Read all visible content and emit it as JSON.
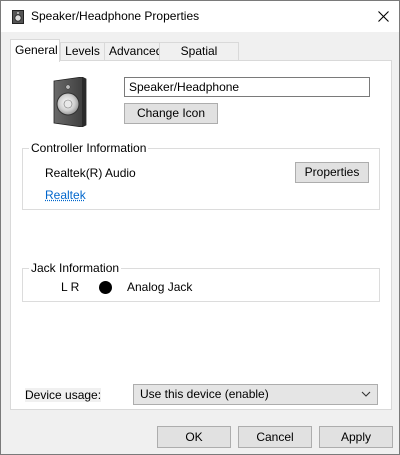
{
  "window": {
    "title": "Speaker/Headphone Properties",
    "close_glyph": "✕"
  },
  "tabs": [
    {
      "label": "General",
      "active": true
    },
    {
      "label": "Levels",
      "active": false
    },
    {
      "label": "Advanced",
      "active": false
    },
    {
      "label": "Spatial sound",
      "active": false
    }
  ],
  "general": {
    "device_name": "Speaker/Headphone",
    "change_icon_label": "Change Icon",
    "controller": {
      "legend": "Controller Information",
      "name": "Realtek(R) Audio",
      "properties_label": "Properties",
      "vendor_link": "Realtek"
    },
    "jack": {
      "legend": "Jack Information",
      "channels": "L R",
      "type": "Analog Jack"
    },
    "device_usage": {
      "label": "Device usage:",
      "selected": "Use this device (enable)"
    }
  },
  "footer": {
    "ok_label": "OK",
    "cancel_label": "Cancel",
    "apply_label": "Apply"
  },
  "colors": {
    "link": "#0066cc",
    "button_face": "#e1e1e1",
    "window_bg": "#f0f0f0"
  }
}
